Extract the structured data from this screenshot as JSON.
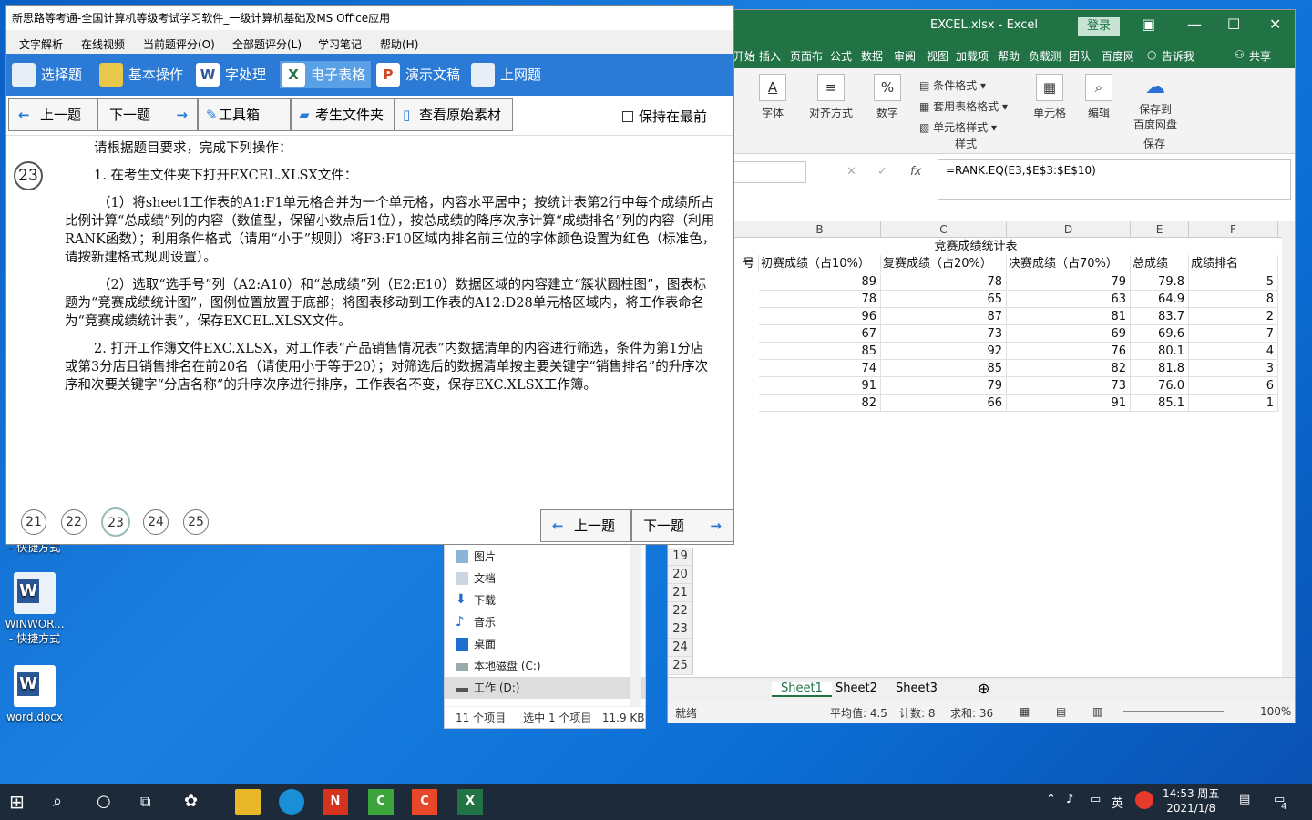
{
  "desktop": {
    "icons": [
      {
        "label": "- 快捷方式"
      },
      {
        "label": "WINWOR...",
        "sublabel": "- 快捷方式"
      },
      {
        "label": "word.docx"
      }
    ]
  },
  "explorer": {
    "items": [
      "图片",
      "文档",
      "下载",
      "音乐",
      "桌面",
      "本地磁盘 (C:)",
      "工作 (D:)"
    ],
    "status": {
      "count": "11 个项目",
      "selected": "选中 1 个项目",
      "size": "11.9 KB"
    }
  },
  "excel": {
    "title": "EXCEL.xlsx  -  Excel",
    "login": "登录",
    "tabs": [
      "开始",
      "插入",
      "页面布",
      "公式",
      "数据",
      "审阅",
      "视图",
      "加载项",
      "帮助",
      "负载测",
      "团队",
      "百度网",
      "告诉我",
      "共享"
    ],
    "ribbon": {
      "font": "字体",
      "align": "对齐方式",
      "number": "数字",
      "cond_format": "条件格式",
      "table_format": "套用表格格式",
      "cell_style": "单元格样式",
      "styles_group": "样式",
      "cells": "单元格",
      "edit": "编辑",
      "save_baidu_1": "保存到",
      "save_baidu_2": "百度网盘",
      "save_group": "保存"
    },
    "formula": "=RANK.EQ(E3,$E$3:$E$10)",
    "columns": [
      "B",
      "C",
      "D",
      "E",
      "F"
    ],
    "table_title": "竞赛成绩统计表",
    "headers": [
      "号",
      "初赛成绩（占10%）",
      "复赛成绩（占20%）",
      "决赛成绩（占70%）",
      "总成绩",
      "成绩排名"
    ],
    "rows": [
      [
        "89",
        "78",
        "79",
        "79.8",
        "5"
      ],
      [
        "78",
        "65",
        "63",
        "64.9",
        "8"
      ],
      [
        "96",
        "87",
        "81",
        "83.7",
        "2"
      ],
      [
        "67",
        "73",
        "69",
        "69.6",
        "7"
      ],
      [
        "85",
        "92",
        "76",
        "80.1",
        "4"
      ],
      [
        "74",
        "85",
        "82",
        "81.8",
        "3"
      ],
      [
        "91",
        "79",
        "73",
        "76.0",
        "6"
      ],
      [
        "82",
        "66",
        "91",
        "85.1",
        "1"
      ]
    ],
    "row_labels": [
      "19",
      "20",
      "21",
      "22",
      "23",
      "24",
      "25"
    ],
    "sheets": [
      "Sheet1",
      "Sheet2",
      "Sheet3"
    ],
    "status": {
      "ready": "就绪",
      "avg": "平均值: 4.5",
      "count": "计数: 8",
      "sum": "求和: 36",
      "zoom": "100%"
    }
  },
  "app": {
    "title": "新思路等考通-全国计算机等级考试学习软件_一级计算机基础及MS Office应用",
    "menu": [
      "文字解析",
      "在线视频",
      "当前题评分(O)",
      "全部题评分(L)",
      "学习笔记",
      "帮助(H)"
    ],
    "nav": [
      "选择题",
      "基本操作",
      "字处理",
      "电子表格",
      "演示文稿",
      "上网题"
    ],
    "toolbar": {
      "prev": "上一题",
      "next": "下一题",
      "tools": "工具箱",
      "folder": "考生文件夹",
      "source": "查看原始素材",
      "keep_top": "保持在最前"
    },
    "question_number": "23",
    "question": {
      "intro": "请根据题目要求，完成下列操作：",
      "p1": "1. 在考生文件夹下打开EXCEL.XLSX文件：",
      "p2": "（1）将sheet1工作表的A1:F1单元格合并为一个单元格，内容水平居中；按统计表第2行中每个成绩所占比例计算“总成绩”列的内容（数值型，保留小数点后1位），按总成绩的降序次序计算“成绩排名”列的内容（利用RANK函数）；利用条件格式（请用“小于”规则）将F3:F10区域内排名前三位的字体颜色设置为红色（标准色，请按新建格式规则设置）。",
      "p3": "（2）选取“选手号”列（A2:A10）和“总成绩”列（E2:E10）数据区域的内容建立“簇状圆柱图”，图表标题为“竞赛成绩统计图”，图例位置放置于底部；将图表移动到工作表的A12:D28单元格区域内，将工作表命名为“竞赛成绩统计表”，保存EXCEL.XLSX文件。",
      "p4": "2. 打开工作簿文件EXC.XLSX，对工作表“产品销售情况表”内数据清单的内容进行筛选，条件为第1分店或第3分店且销售排名在前20名（请使用小于等于20）；对筛选后的数据清单按主要关键字“销售排名”的升序次序和次要关键字“分店名称”的升序次序进行排序，工作表名不变，保存EXC.XLSX工作簿。"
    },
    "pages": [
      "21",
      "22",
      "23",
      "24",
      "25"
    ],
    "bottom": {
      "prev": "上一题",
      "next": "下一题"
    }
  },
  "taskbar": {
    "ime": "英",
    "time": "14:53 周五",
    "date": "2021/1/8",
    "notif": "4"
  }
}
